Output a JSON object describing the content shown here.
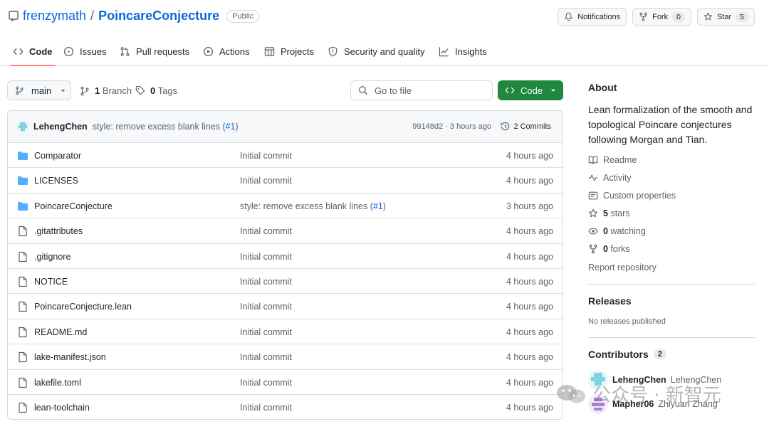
{
  "header": {
    "owner": "frenzymath",
    "separator": "/",
    "repo": "PoincareConjecture",
    "visibility": "Public",
    "notifications_label": "Notifications",
    "fork_label": "Fork",
    "fork_count": "0",
    "star_label": "Star",
    "star_count": "5"
  },
  "tabs": [
    {
      "label": "Code",
      "icon": "code-icon",
      "active": true
    },
    {
      "label": "Issues",
      "icon": "issue-icon"
    },
    {
      "label": "Pull requests",
      "icon": "pull-request-icon"
    },
    {
      "label": "Actions",
      "icon": "play-icon"
    },
    {
      "label": "Projects",
      "icon": "table-icon"
    },
    {
      "label": "Security and quality",
      "icon": "shield-icon"
    },
    {
      "label": "Insights",
      "icon": "graph-icon"
    }
  ],
  "toolbar": {
    "branch": "main",
    "branch_count": "1",
    "branch_label": "Branch",
    "tag_count": "0",
    "tag_label": "Tags",
    "goto_placeholder": "Go to file",
    "code_label": "Code"
  },
  "latest_commit": {
    "author": "LehengChen",
    "message": "style: remove excess blank lines (",
    "pr": "#1",
    "message_end": ")",
    "hash_time": "99148d2 · 3 hours ago",
    "commits_label": "2 Commits"
  },
  "files": [
    {
      "name": "Comparator",
      "type": "dir",
      "message": "Initial commit",
      "time": "4 hours ago"
    },
    {
      "name": "LICENSES",
      "type": "dir",
      "message": "Initial commit",
      "time": "4 hours ago"
    },
    {
      "name": "PoincareConjecture",
      "type": "dir",
      "message": "style: remove excess blank lines (",
      "pr": "#1",
      "message_end": ")",
      "time": "3 hours ago"
    },
    {
      "name": ".gitattributes",
      "type": "file",
      "message": "Initial commit",
      "time": "4 hours ago"
    },
    {
      "name": ".gitignore",
      "type": "file",
      "message": "Initial commit",
      "time": "4 hours ago"
    },
    {
      "name": "NOTICE",
      "type": "file",
      "message": "Initial commit",
      "time": "4 hours ago"
    },
    {
      "name": "PoincareConjecture.lean",
      "type": "file",
      "message": "Initial commit",
      "time": "4 hours ago"
    },
    {
      "name": "README.md",
      "type": "file",
      "message": "Initial commit",
      "time": "4 hours ago"
    },
    {
      "name": "lake-manifest.json",
      "type": "file",
      "message": "Initial commit",
      "time": "4 hours ago"
    },
    {
      "name": "lakefile.toml",
      "type": "file",
      "message": "Initial commit",
      "time": "4 hours ago"
    },
    {
      "name": "lean-toolchain",
      "type": "file",
      "message": "Initial commit",
      "time": "4 hours ago"
    }
  ],
  "sidebar": {
    "about_title": "About",
    "description": "Lean formalization of the smooth and topological Poincare conjectures following Morgan and Tian.",
    "readme": "Readme",
    "activity": "Activity",
    "custom_properties": "Custom properties",
    "stars_count": "5",
    "stars_label": "stars",
    "watching_count": "0",
    "watching_label": "watching",
    "forks_count": "0",
    "forks_label": "forks",
    "report": "Report repository",
    "releases_title": "Releases",
    "no_releases": "No releases published",
    "contributors_title": "Contributors",
    "contributors_count": "2",
    "contributors": [
      {
        "login": "LehengChen",
        "name": "LehengChen"
      },
      {
        "login": "Mapher06",
        "name": "Zhiyuan Zhang"
      }
    ]
  },
  "watermark": {
    "text": "公众号 · 新智元"
  },
  "colors": {
    "accent": "#0969da",
    "green": "#1f883d",
    "tab_underline": "#fd8c73",
    "folder": "#54aeff"
  }
}
